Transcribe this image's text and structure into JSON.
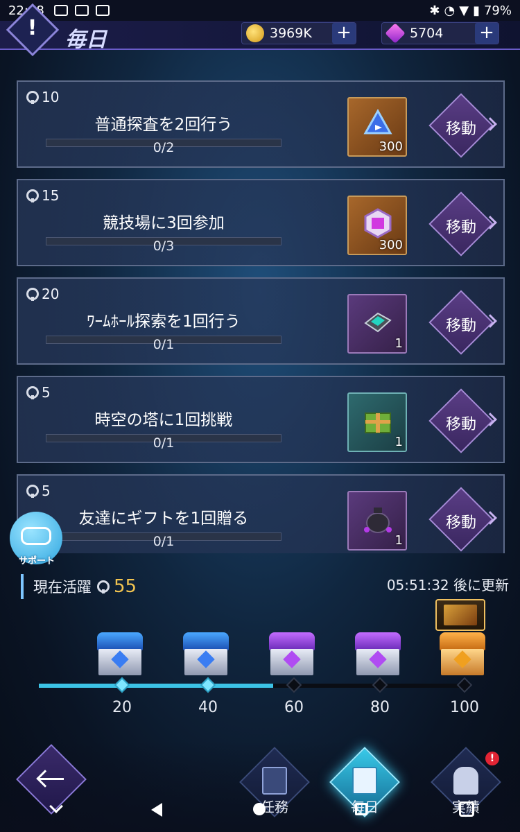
{
  "status_bar": {
    "time": "22:08",
    "battery": "79%"
  },
  "header": {
    "title": "毎日",
    "alert_icon": "exclamation-icon"
  },
  "currencies": {
    "coins": {
      "value": "3969K",
      "icon": "coin-icon"
    },
    "gems": {
      "value": "5704",
      "icon": "gem-icon"
    }
  },
  "missions": [
    {
      "points": "10",
      "title": "普通探査を2回行う",
      "progress": "0/2",
      "fraction": 0.0,
      "reward_qty": "300",
      "reward_icon": "blue-crystal-icon",
      "reward_style": "gold",
      "button": "移動"
    },
    {
      "points": "15",
      "title": "競技場に3回参加",
      "progress": "0/3",
      "fraction": 0.0,
      "reward_qty": "300",
      "reward_icon": "purple-hexagon-icon",
      "reward_style": "gold",
      "button": "移動"
    },
    {
      "points": "20",
      "title": "ﾜｰﾑﾎｰﾙ探索を1回行う",
      "progress": "0/1",
      "fraction": 0.0,
      "reward_qty": "1",
      "reward_icon": "chip-module-icon",
      "reward_style": "purple",
      "button": "移動"
    },
    {
      "points": "5",
      "title": "時空の塔に1回挑戦",
      "progress": "0/1",
      "fraction": 0.0,
      "reward_qty": "1",
      "reward_icon": "gift-box-icon",
      "reward_style": "teal",
      "button": "移動"
    },
    {
      "points": "5",
      "title": "友達にギフトを1回贈る",
      "progress": "0/1",
      "fraction": 0.0,
      "reward_qty": "1",
      "reward_icon": "bag-icon",
      "reward_style": "purple",
      "button": "移動"
    }
  ],
  "support": {
    "label": "サポート",
    "icon": "gamepad-icon"
  },
  "activity": {
    "label": "現在活躍",
    "value": "55",
    "refresh": "05:51:32 後に更新",
    "progress_points": 55,
    "max_points": 100
  },
  "milestones": [
    {
      "label": "20",
      "chest": "blue",
      "reached": true
    },
    {
      "label": "40",
      "chest": "blue",
      "reached": true
    },
    {
      "label": "60",
      "chest": "violet",
      "reached": false
    },
    {
      "label": "80",
      "chest": "violet",
      "reached": false
    },
    {
      "label": "100",
      "chest": "orange",
      "reached": false
    }
  ],
  "bottom_tabs": [
    {
      "label": "任務",
      "icon": "notebook-star-icon",
      "active": false
    },
    {
      "label": "毎日",
      "icon": "calendar-star-icon",
      "active": true
    },
    {
      "label": "実績",
      "icon": "trophy-icon",
      "active": false,
      "badge": "!"
    }
  ]
}
